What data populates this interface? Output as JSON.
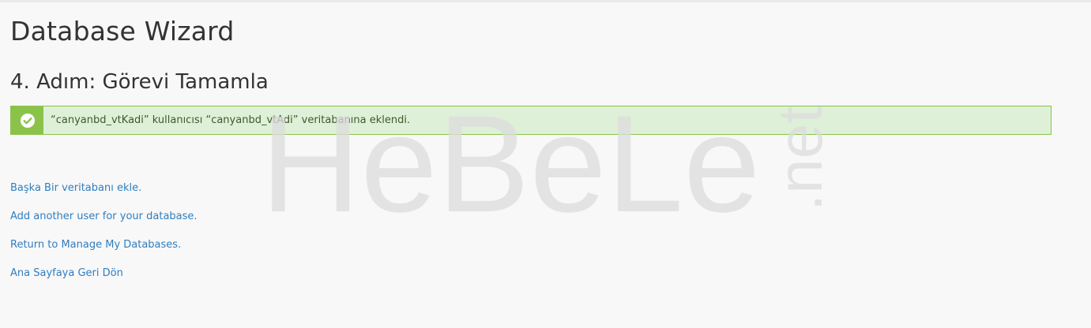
{
  "header": {
    "title": "Database Wizard"
  },
  "step": {
    "title": "4. Adım: Görevi Tamamla"
  },
  "alert": {
    "icon": "check-circle-icon",
    "message": "“canyanbd_vtKadi” kullanıcısı “canyanbd_vtAdi” veritabanına eklendi.",
    "color": "#8bc34a",
    "background": "#dff0d8"
  },
  "links": [
    {
      "label": "Başka Bir veritabanı ekle."
    },
    {
      "label": "Add another user for your database."
    },
    {
      "label": "Return to Manage My Databases."
    },
    {
      "label": "Ana Sayfaya Geri Dön"
    }
  ],
  "watermark": {
    "main": "HeBeLe",
    "suffix": ".net"
  },
  "colors": {
    "link": "#2f7ec0",
    "text": "#333333",
    "page_background": "#f8f8f8"
  }
}
